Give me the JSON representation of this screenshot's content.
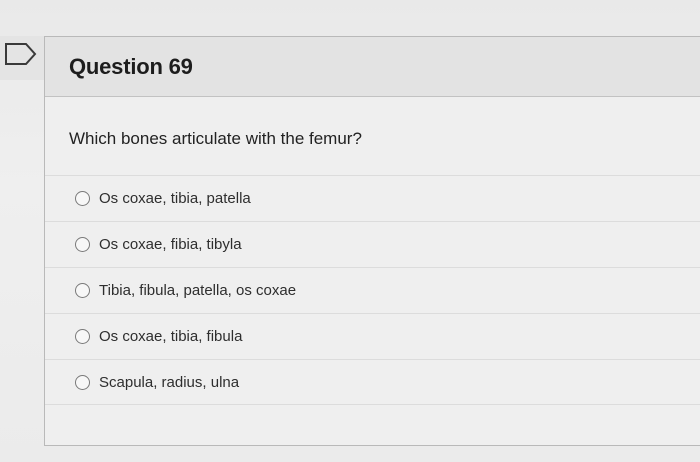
{
  "question": {
    "title": "Question 69",
    "text": "Which bones articulate with the femur?"
  },
  "options": [
    {
      "label": "Os coxae, tibia, patella",
      "selected": false
    },
    {
      "label": "Os coxae, fibia, tibyla",
      "selected": false
    },
    {
      "label": "Tibia, fibula, patella, os coxae",
      "selected": false
    },
    {
      "label": "Os coxae, tibia, fibula",
      "selected": false
    },
    {
      "label": "Scapula, radius, ulna",
      "selected": false
    }
  ],
  "icons": {
    "flag": "flag-icon"
  },
  "colors": {
    "header_bg": "#e3e3e3",
    "card_bg": "#efefef",
    "border": "#b9b9b9"
  }
}
